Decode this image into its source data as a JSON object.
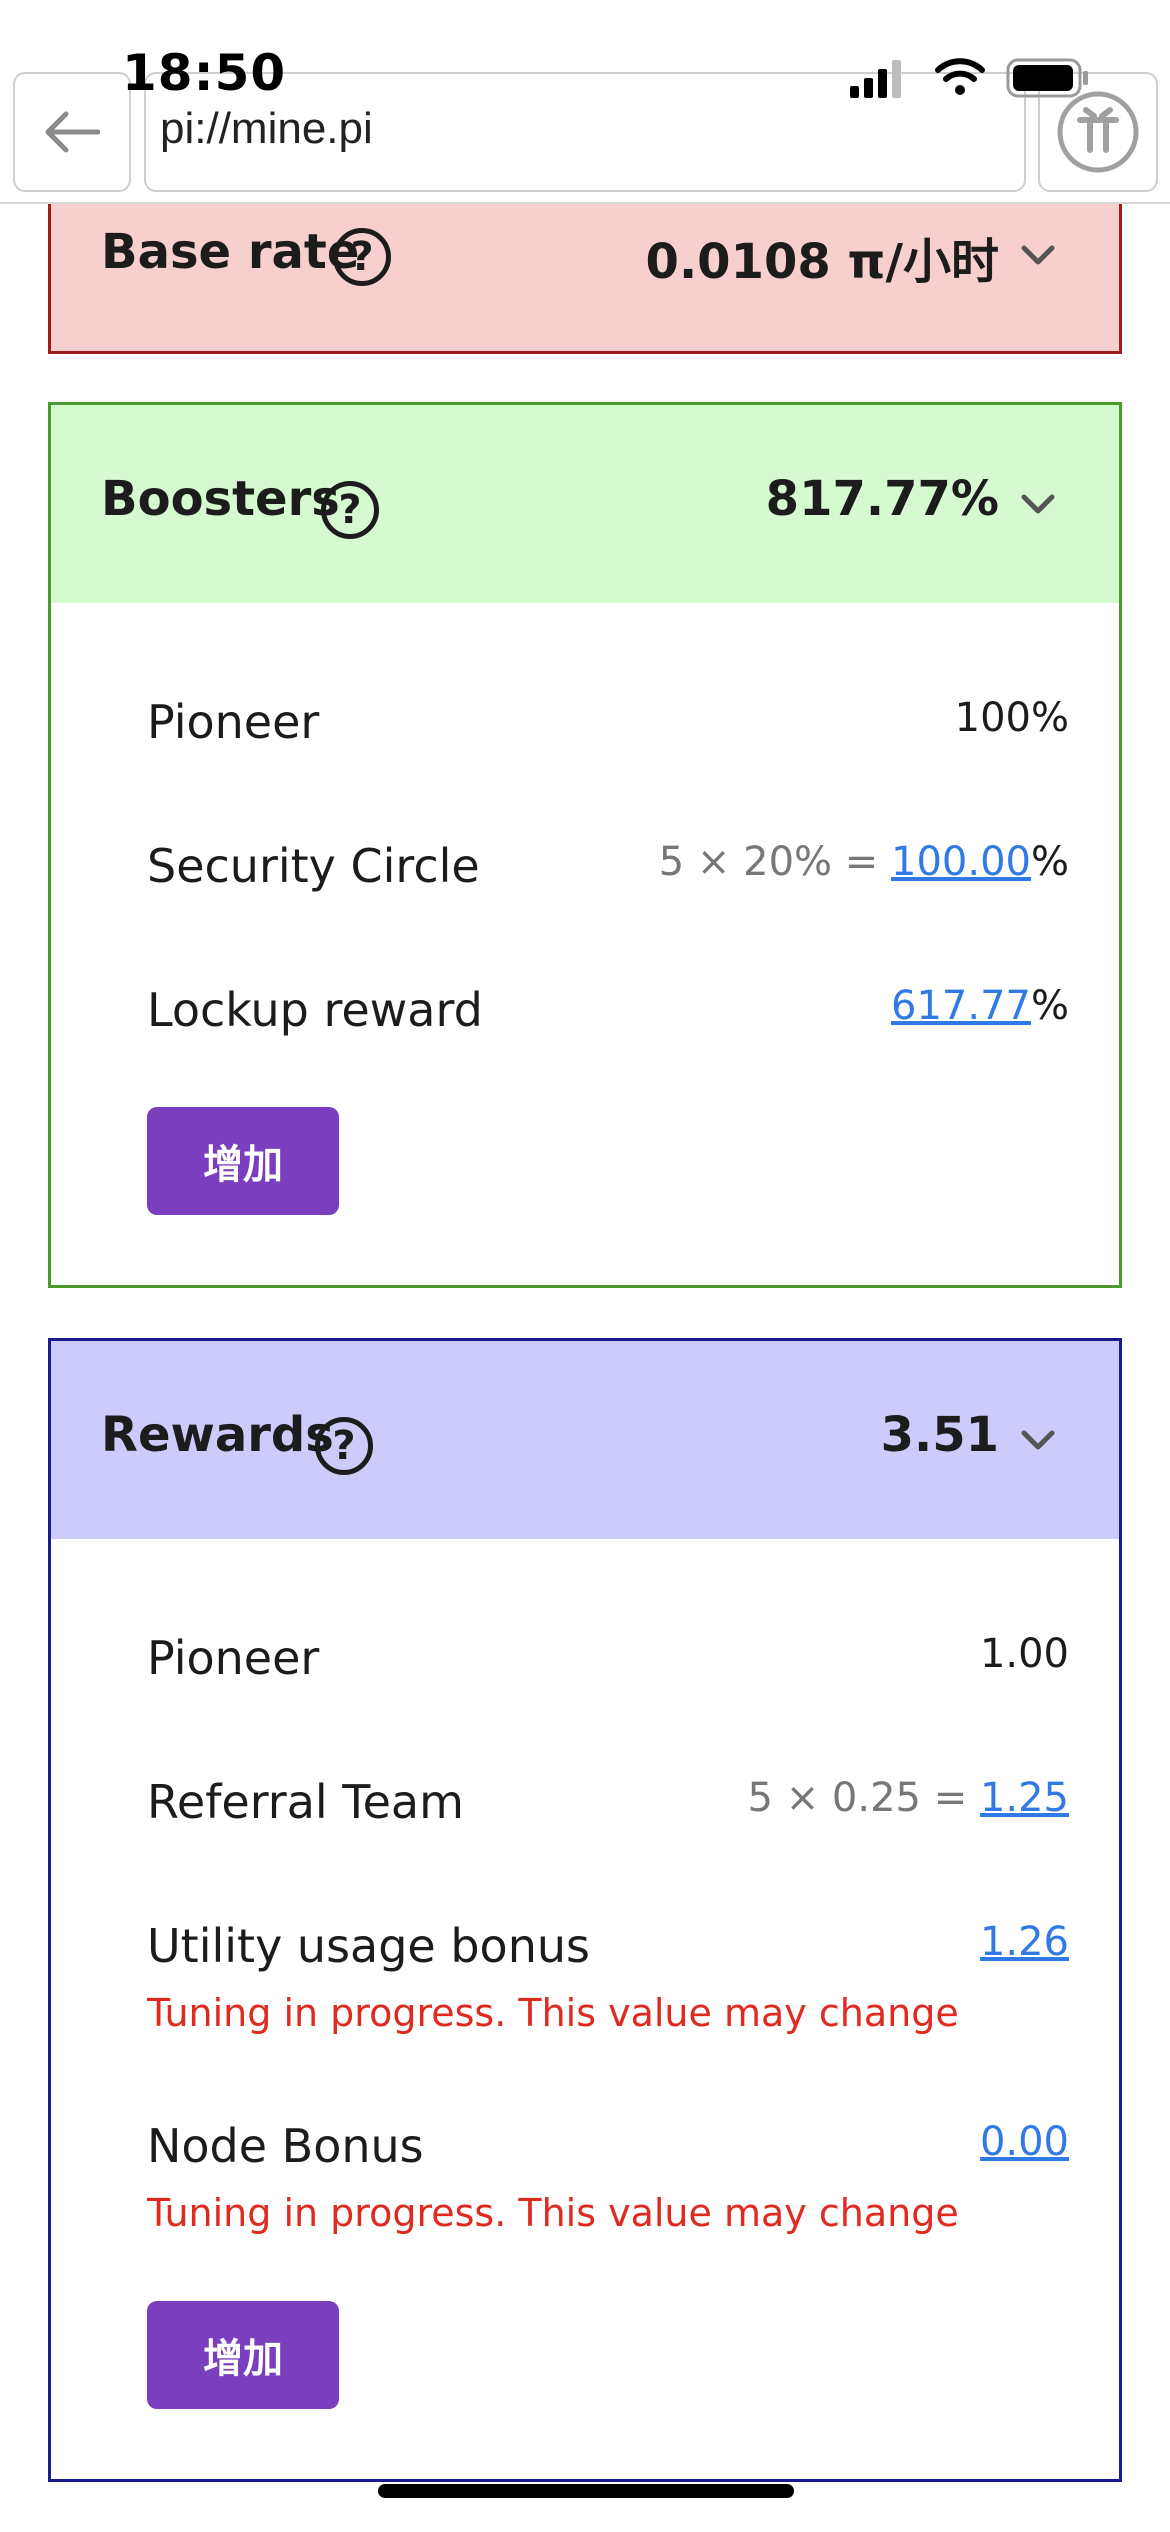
{
  "status_bar": {
    "time": "18:50"
  },
  "browser": {
    "url": "pi://mine.pi"
  },
  "base_rate": {
    "title": "Base rate",
    "value": "0.0108 π/小时"
  },
  "boosters": {
    "title": "Boosters",
    "value": "817.77%",
    "rows": [
      {
        "label": "Pioneer",
        "value": "100%"
      },
      {
        "label": "Security Circle",
        "prefix": "5 × 20% = ",
        "link": "100.00",
        "suffix": "%"
      },
      {
        "label": "Lockup reward",
        "link": "617.77",
        "suffix": "%"
      }
    ],
    "add_label": "增加"
  },
  "rewards": {
    "title": "Rewards",
    "value": "3.51",
    "rows": [
      {
        "label": "Pioneer",
        "value": "1.00"
      },
      {
        "label": "Referral Team",
        "prefix": "5 × 0.25 = ",
        "link": "1.25"
      },
      {
        "label": "Utility usage bonus",
        "link": "1.26",
        "warning": "Tuning in progress. This value may change"
      },
      {
        "label": "Node Bonus",
        "link": "0.00",
        "warning": "Tuning in progress. This value may change"
      }
    ],
    "add_label": "增加"
  },
  "colors": {
    "base_rate_bg": "#f8cfcf",
    "base_rate_border": "#a01c1c",
    "boosters_bg": "#d5fad0",
    "boosters_border": "#4a9a2e",
    "rewards_bg": "#cccbfa",
    "rewards_border": "#1a1a8c",
    "button": "#7a3ebf",
    "link": "#2f7ae5",
    "warning": "#e02a1f"
  }
}
